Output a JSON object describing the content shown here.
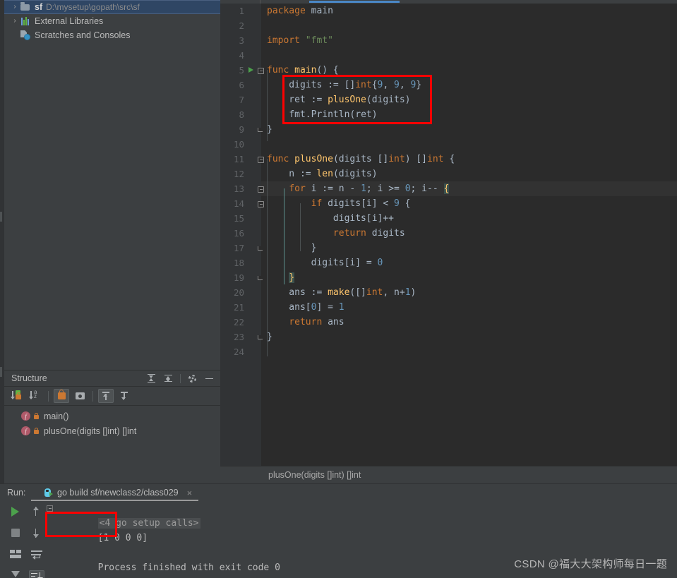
{
  "project": {
    "items": [
      {
        "icon": "folder-icon",
        "twisty": "›",
        "name": "sf",
        "path": "D:\\mysetup\\gopath\\src\\sf",
        "selected": true
      },
      {
        "icon": "library-icon",
        "twisty": "›",
        "name": "External Libraries",
        "path": "",
        "selected": false
      },
      {
        "icon": "scratches-icon",
        "twisty": "",
        "name": "Scratches and Consoles",
        "path": "",
        "selected": false
      }
    ]
  },
  "structure": {
    "title": "Structure",
    "header_actions": [
      {
        "name": "expand-all-icon",
        "label": "Expand All"
      },
      {
        "name": "collapse-all-icon",
        "label": "Collapse All"
      },
      {
        "name": "gear-icon",
        "label": "Settings"
      },
      {
        "name": "minimize-icon",
        "label": "Hide"
      }
    ],
    "toolbar": [
      {
        "name": "sort-by-visibility-button",
        "active": false
      },
      {
        "name": "sort-alphabetically-button",
        "active": false
      },
      {
        "name": "show-non-public-button",
        "active": true
      },
      {
        "name": "show-fields-button",
        "active": false
      },
      {
        "name": "scroll-from-source-button",
        "active": true
      },
      {
        "name": "scroll-to-source-button",
        "active": false
      }
    ],
    "items": [
      {
        "kind": "f",
        "label": "main()"
      },
      {
        "kind": "f",
        "label": "plusOne(digits []int) []int"
      }
    ]
  },
  "editor": {
    "breadcrumb": "plusOne(digits []int) []int",
    "lines": [
      {
        "n": 1,
        "text": "package main"
      },
      {
        "n": 2,
        "text": ""
      },
      {
        "n": 3,
        "text": "import \"fmt\""
      },
      {
        "n": 4,
        "text": ""
      },
      {
        "n": 5,
        "text": "func main() {"
      },
      {
        "n": 6,
        "text": "    digits := []int{9, 9, 9}"
      },
      {
        "n": 7,
        "text": "    ret := plusOne(digits)"
      },
      {
        "n": 8,
        "text": "    fmt.Println(ret)"
      },
      {
        "n": 9,
        "text": "}"
      },
      {
        "n": 10,
        "text": ""
      },
      {
        "n": 11,
        "text": "func plusOne(digits []int) []int {"
      },
      {
        "n": 12,
        "text": "    n := len(digits)"
      },
      {
        "n": 13,
        "text": "    for i := n - 1; i >= 0; i-- {"
      },
      {
        "n": 14,
        "text": "        if digits[i] < 9 {"
      },
      {
        "n": 15,
        "text": "            digits[i]++"
      },
      {
        "n": 16,
        "text": "            return digits"
      },
      {
        "n": 17,
        "text": "        }"
      },
      {
        "n": 18,
        "text": "        digits[i] = 0"
      },
      {
        "n": 19,
        "text": "    }"
      },
      {
        "n": 20,
        "text": "    ans := make([]int, n+1)"
      },
      {
        "n": 21,
        "text": "    ans[0] = 1"
      },
      {
        "n": 22,
        "text": "    return ans"
      },
      {
        "n": 23,
        "text": "}"
      },
      {
        "n": 24,
        "text": ""
      }
    ]
  },
  "run": {
    "label": "Run:",
    "tab_title": "go build sf/newclass2/class029",
    "tab_close": "×",
    "console": {
      "folded_line": "<4 go setup calls>",
      "output": "[1 0 0 0]",
      "blank": "",
      "exit": "Process finished with exit code 0"
    },
    "sidebar": [
      {
        "name": "rerun-button"
      },
      {
        "name": "stop-button"
      },
      {
        "name": "layout-button"
      },
      {
        "name": "pin-tab-button"
      }
    ],
    "sidebar2": [
      {
        "name": "prev-occurrence-button"
      },
      {
        "name": "next-occurrence-button"
      },
      {
        "name": "soft-wrap-button"
      },
      {
        "name": "scroll-to-end-button"
      }
    ]
  },
  "annotations": {
    "watermark": "CSDN @福大大架构师每日一题",
    "boxes": [
      {
        "name": "code-highlight-box",
        "color": "#ff0000"
      },
      {
        "name": "output-highlight-box",
        "color": "#ff0000"
      }
    ]
  },
  "colors": {
    "accent_blue": "#4a88c7",
    "editor_bg": "#2b2b2b",
    "panel_bg": "#3c3f41",
    "gutter_bg": "#313335",
    "selection_blue": "#2f4664",
    "keyword": "#cc7832",
    "string": "#6a8759",
    "number": "#6897bb",
    "function": "#ffc66d",
    "default_text": "#a9b7c6",
    "highlight_red": "#ff0000"
  }
}
